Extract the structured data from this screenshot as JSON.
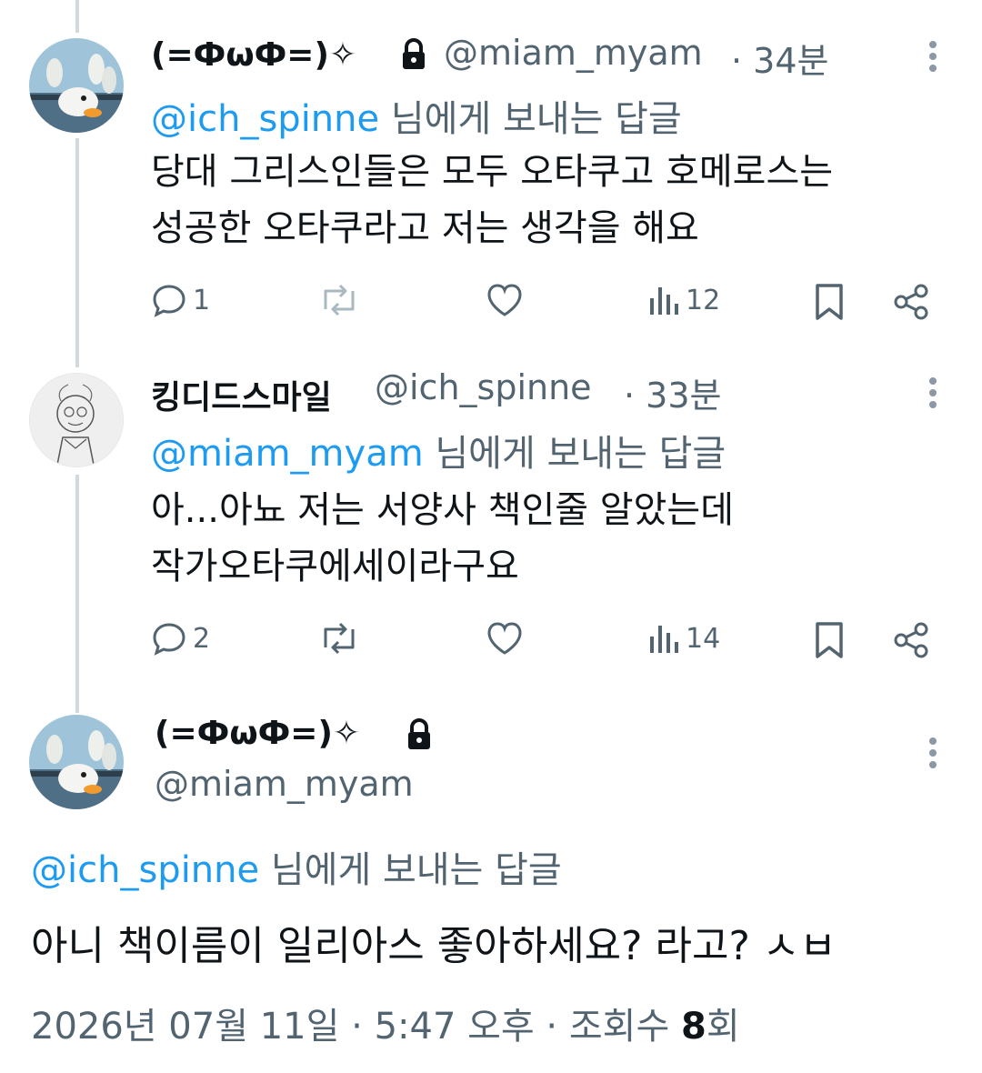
{
  "tweets": [
    {
      "display_name": "(=ФωФ=)✧",
      "handle": "@miam_myam",
      "time": "· 34분",
      "reply_to_handle": "@ich_spinne",
      "reply_to_suffix": " 님에게 보내는 답글",
      "text_line1": "당대 그리스인들은 모두 오타쿠고 호메로스는",
      "text_line2": "성공한 오타쿠라고 저는 생각을 해요",
      "reply_count": "1",
      "views": "12"
    },
    {
      "display_name": "킹디드스마일",
      "handle": "@ich_spinne",
      "time": "· 33분",
      "reply_to_handle": "@miam_myam",
      "reply_to_suffix": " 님에게 보내는 답글",
      "text_line1": "아...아뇨 저는 서양사 책인줄 알았는데",
      "text_line2": "작가오타쿠에세이라구요",
      "reply_count": "2",
      "views": "14"
    }
  ],
  "main": {
    "display_name": "(=ФωФ=)✧",
    "handle": "@miam_myam",
    "reply_to_handle": "@ich_spinne",
    "reply_to_suffix": " 님에게 보내는 답글",
    "text": "아니 책이름이 일리아스 좋아하세요? 라고? ㅅㅂ",
    "timestamp": "2026년 07월 11일 · 5:47 오후 · 조회수 ",
    "view_count": "8",
    "view_suffix": "회"
  },
  "icons": [
    "lock-icon",
    "more-icon",
    "reply-icon",
    "retweet-icon",
    "like-icon",
    "views-icon",
    "bookmark-icon",
    "share-icon"
  ],
  "colors": {
    "link": "#1d9bf0",
    "muted": "#536471",
    "text": "#0f1419",
    "thread_line": "#cfd9de"
  }
}
